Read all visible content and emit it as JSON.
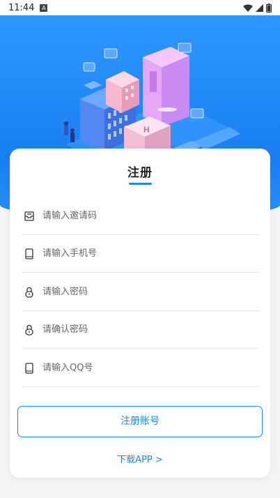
{
  "status_bar": {
    "time": "11:44",
    "note_icon": "A",
    "icons": [
      "wifi-icon",
      "signal-icon",
      "battery-icon"
    ]
  },
  "form": {
    "title": "注册",
    "fields": [
      {
        "placeholder": "请输入邀请码",
        "value": "",
        "icon": "invite-box-icon"
      },
      {
        "placeholder": "请输入手机号",
        "value": "",
        "icon": "phone-icon"
      },
      {
        "placeholder": "请输入密码",
        "value": "",
        "icon": "lock-icon"
      },
      {
        "placeholder": "请确认密码",
        "value": "",
        "icon": "lock-icon"
      },
      {
        "placeholder": "请输入QQ号",
        "value": "",
        "icon": "phone-icon"
      }
    ],
    "submit_label": "注册账号",
    "download_label": "下载APP >"
  },
  "colors": {
    "accent": "#1e88f0",
    "hero_top": "#2f97ff",
    "hero_bottom": "#1a7ff3",
    "background": "#f3f4f6"
  }
}
